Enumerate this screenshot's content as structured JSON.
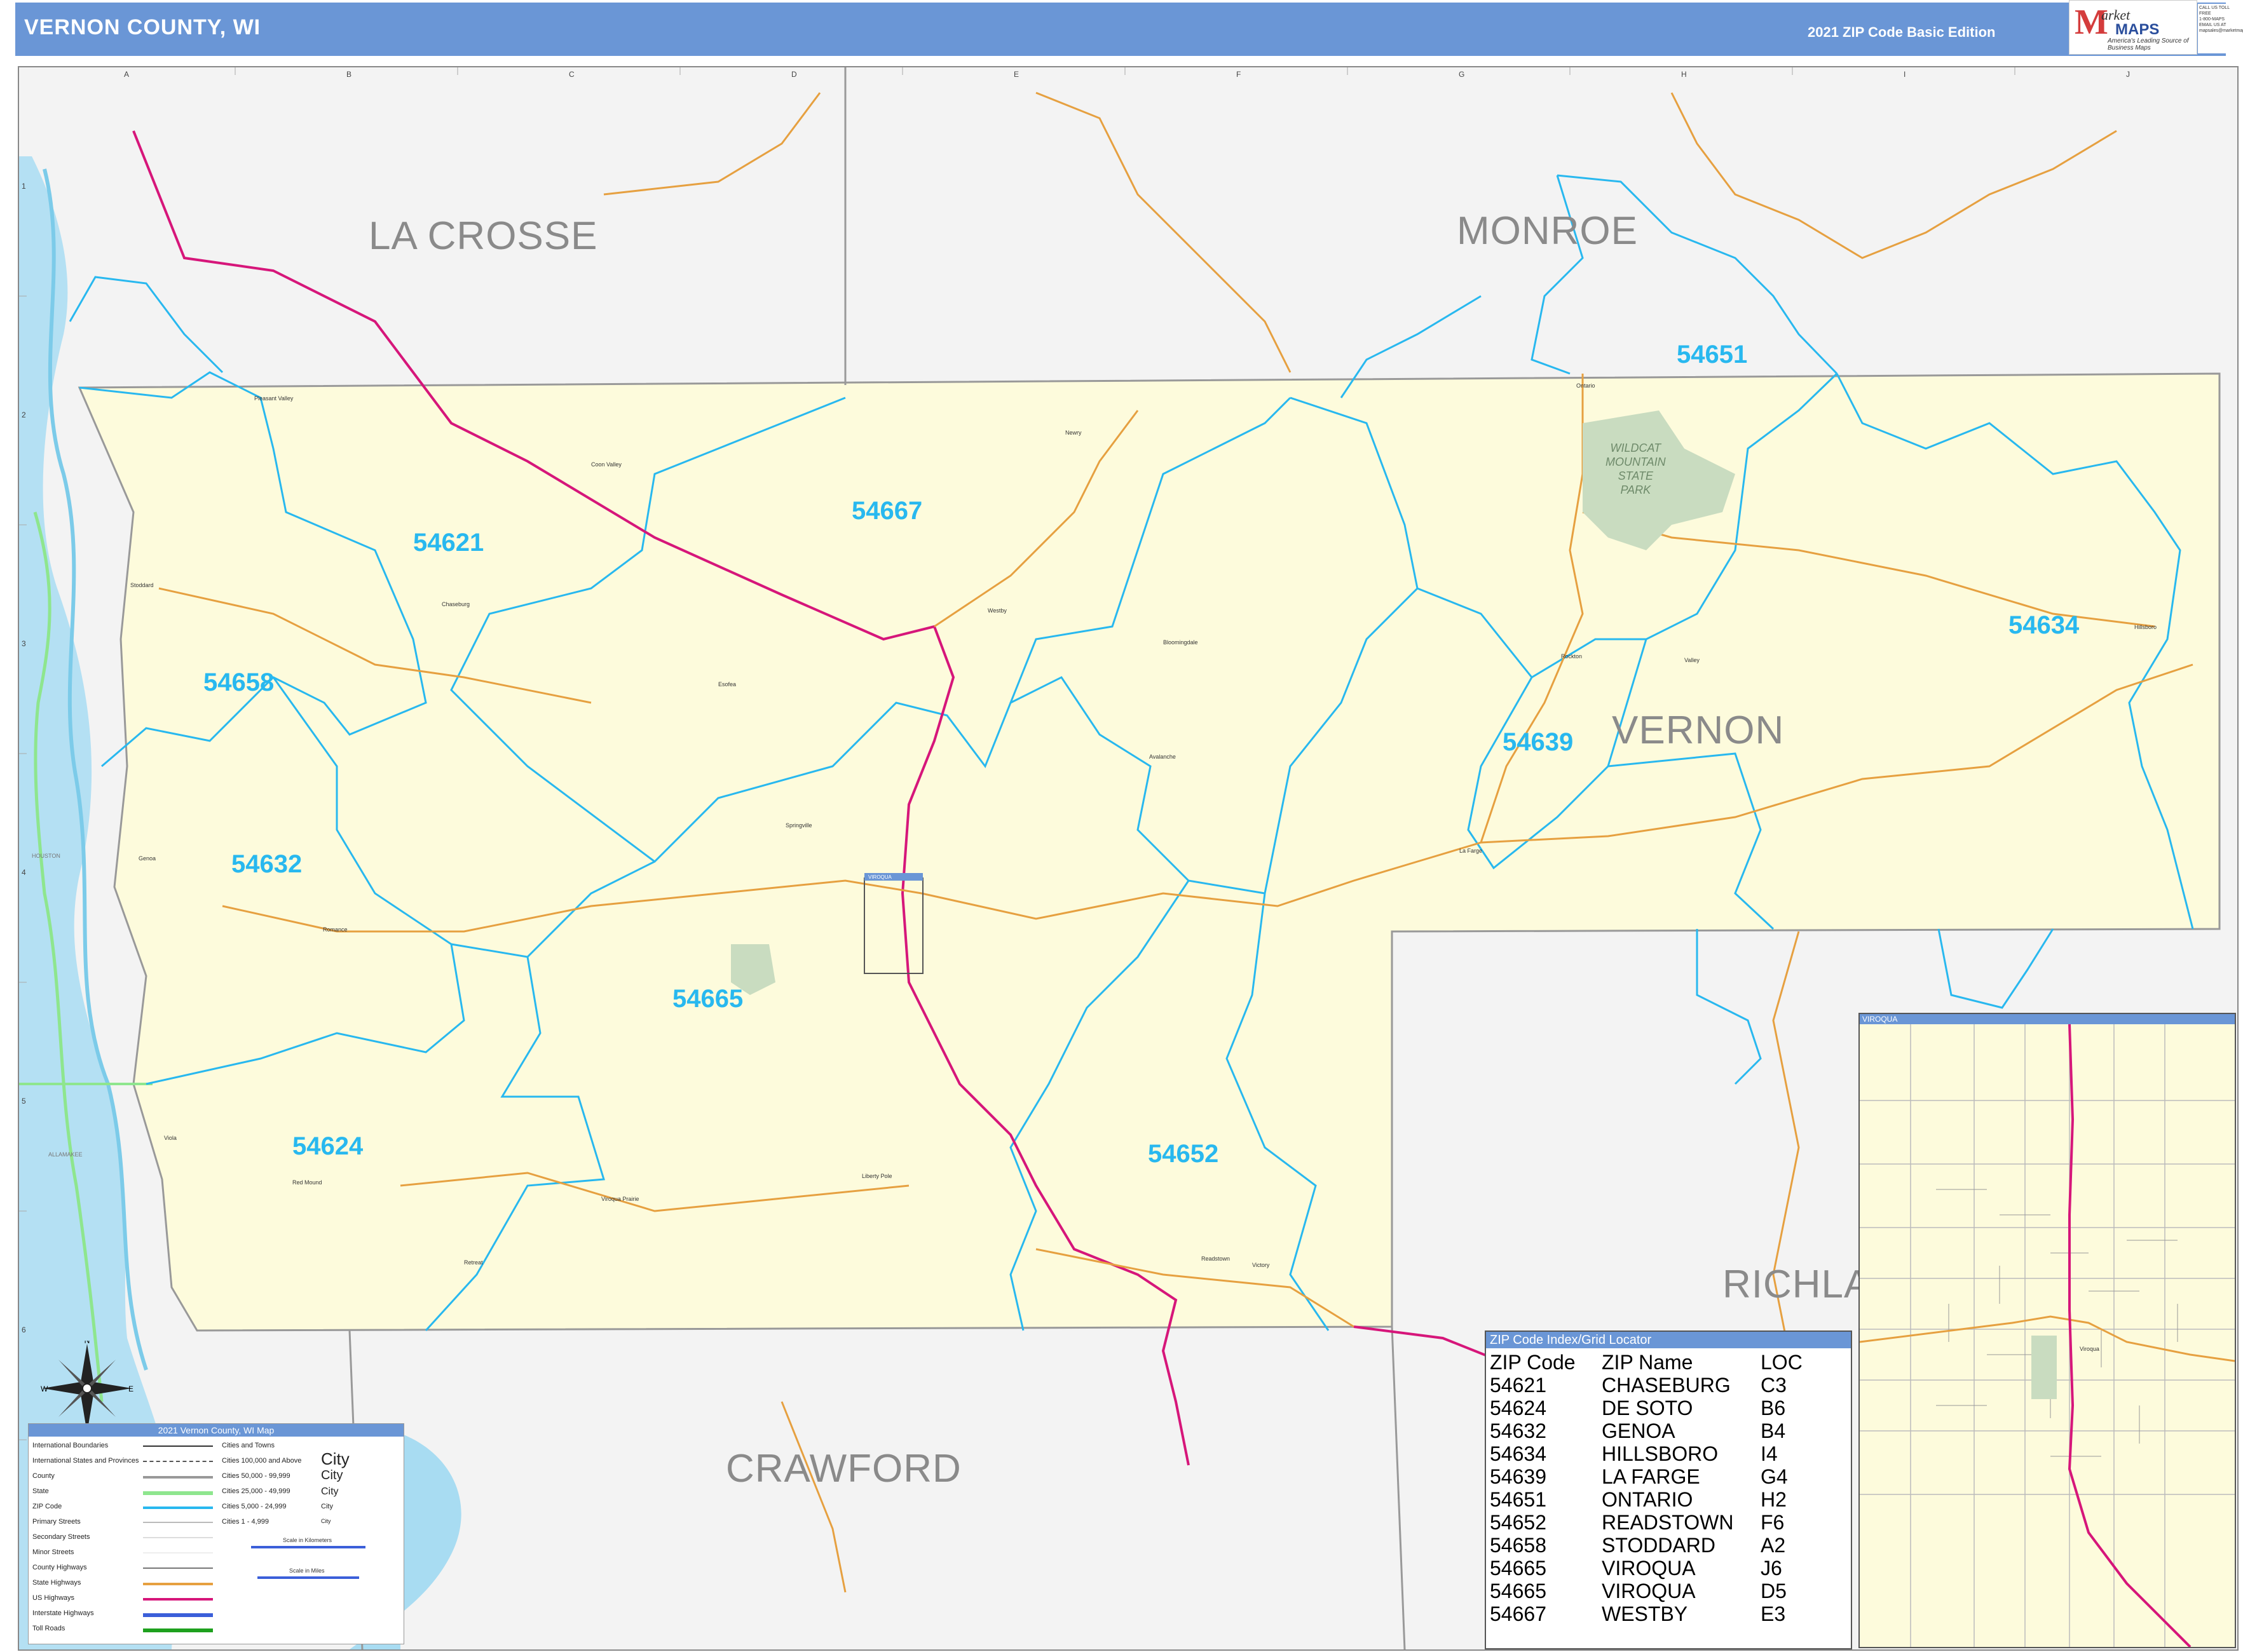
{
  "header": {
    "title": "VERNON COUNTY, WI",
    "edition": "2021 ZIP Code Basic Edition",
    "logo_mark": "M",
    "logo_arc": "arket",
    "logo_text": "MAPS",
    "logo_tagline": "America's Leading Source of Business Maps",
    "contact_lines": [
      "CALL US TOLL FREE",
      "1-800-MAPS",
      "EMAIL US AT",
      "mapsales@marketmaps.com"
    ]
  },
  "grid": {
    "columns": [
      "A",
      "B",
      "C",
      "D",
      "E",
      "F",
      "G",
      "H",
      "I",
      "J"
    ],
    "rows": [
      "1",
      "2",
      "3",
      "4",
      "5",
      "6"
    ]
  },
  "counties": [
    {
      "name": "LA CROSSE"
    },
    {
      "name": "MONROE"
    },
    {
      "name": "VERNON"
    },
    {
      "name": "RICHLA"
    },
    {
      "name": "CRAWFORD"
    }
  ],
  "zips": [
    "54651",
    "54667",
    "54621",
    "54634",
    "54658",
    "54639",
    "54632",
    "54665",
    "54624",
    "54652"
  ],
  "places": [
    "Pleasant Valley",
    "Coon Valley",
    "Stoddard",
    "Chaseburg",
    "Westby",
    "Esofea",
    "Genoa",
    "Springville",
    "Romance",
    "Liberty Pole",
    "Red Mound",
    "Viola",
    "Readstown",
    "Viroqua",
    "La Farge",
    "Rockton",
    "Valley",
    "Hillsboro",
    "Ontario",
    "Newry",
    "Bloomingdale",
    "Avalanche",
    "Victory",
    "Retreat",
    "Viroqua Prairie",
    "HOUSTON",
    "ALLAMAKEE"
  ],
  "park": {
    "line1": "WILDCAT",
    "line2": "MOUNTAIN",
    "line3": "STATE",
    "line4": "PARK"
  },
  "inset_label": "VIROQUA",
  "inset_marker_label": "VIROQUA",
  "inset_place": "Viroqua",
  "compass": {
    "n": "N",
    "s": "S",
    "e": "E",
    "w": "W"
  },
  "legend": {
    "title": "2021 Vernon County, WI Map",
    "items": [
      "International Boundaries",
      "International States and Provinces",
      "County",
      "State",
      "ZIP Code",
      "Primary Streets",
      "Secondary Streets",
      "Minor Streets",
      "County Highways",
      "State Highways",
      "US Highways",
      "Interstate Highways",
      "Toll Roads"
    ],
    "cities_header": "Cities and Towns",
    "cities": [
      {
        "label": "Cities 100,000 and Above",
        "sample": "City"
      },
      {
        "label": "Cities 50,000 - 99,999",
        "sample": "City"
      },
      {
        "label": "Cities 25,000 - 49,999",
        "sample": "City"
      },
      {
        "label": "Cities 5,000 - 24,999",
        "sample": "City"
      },
      {
        "label": "Cities 1 - 4,999",
        "sample": "City"
      }
    ],
    "scale_km": "Scale in Kilometers",
    "scale_mi": "Scale in Miles",
    "colors": {
      "county": "#999999",
      "state": "#8ee68e",
      "zip": "#28b8ef",
      "us_hwy": "#d6167a",
      "state_hwy": "#e6a040",
      "interstate": "#3b5fd9",
      "toll": "#1ea01e"
    }
  },
  "index": {
    "title": "ZIP Code Index/Grid Locator",
    "headers": [
      "ZIP Code",
      "ZIP Name",
      "LOC"
    ],
    "rows": [
      [
        "54621",
        "CHASEBURG",
        "C3"
      ],
      [
        "54624",
        "DE SOTO",
        "B6"
      ],
      [
        "54632",
        "GENOA",
        "B4"
      ],
      [
        "54634",
        "HILLSBORO",
        "I4"
      ],
      [
        "54639",
        "LA FARGE",
        "G4"
      ],
      [
        "54651",
        "ONTARIO",
        "H2"
      ],
      [
        "54652",
        "READSTOWN",
        "F6"
      ],
      [
        "54658",
        "STODDARD",
        "A2"
      ],
      [
        "54665",
        "VIROQUA",
        "J6"
      ],
      [
        "54665",
        "VIROQUA",
        "D5"
      ],
      [
        "54667",
        "WESTBY",
        "E3"
      ]
    ]
  },
  "theme": {
    "county_fill": "#fdfbdc",
    "outside_fill": "#f3f3f3",
    "water": "#a8dcf2",
    "header": "#6a96d6"
  }
}
